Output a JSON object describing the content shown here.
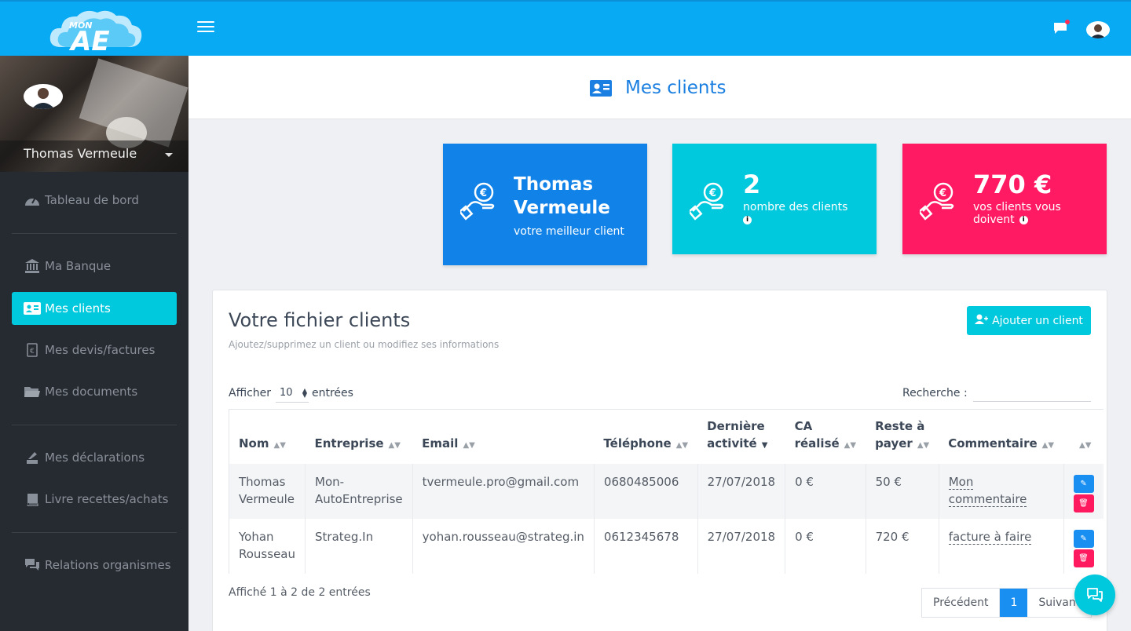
{
  "brand": {
    "logo_small": "MON",
    "logo_big": "AE"
  },
  "topbar": {
    "menu_icon": "hamburger-icon",
    "chat_icon": "chat-icon",
    "avatar": "user-avatar"
  },
  "sidebar": {
    "user_name": "Thomas Vermeule",
    "items": [
      {
        "label": "Tableau de bord",
        "icon": "dashboard-icon"
      },
      {
        "label": "Ma Banque",
        "icon": "bank-icon"
      },
      {
        "label": "Mes clients",
        "icon": "contact-card-icon",
        "active": true
      },
      {
        "label": "Mes devis/factures",
        "icon": "invoice-icon"
      },
      {
        "label": "Mes documents",
        "icon": "folder-icon"
      },
      {
        "label": "Mes déclarations",
        "icon": "declaration-icon"
      },
      {
        "label": "Livre recettes/achats",
        "icon": "book-icon"
      },
      {
        "label": "Relations organismes",
        "icon": "conversation-icon"
      }
    ]
  },
  "page": {
    "title": "Mes clients"
  },
  "cards": [
    {
      "name": "Thomas Vermeule",
      "name_line1": "Thomas",
      "name_line2": "Vermeule",
      "subtitle": "votre meilleur client",
      "color": "#1183e8"
    },
    {
      "value": "2",
      "subtitle": "nombre des clients",
      "color": "#00c8dd"
    },
    {
      "value": "770 €",
      "subtitle_line1": "vos clients vous",
      "subtitle_line2": "doivent",
      "color": "#ff1a63"
    }
  ],
  "panel": {
    "title": "Votre fichier clients",
    "subtitle": "Ajoutez/supprimez un client ou modifiez ses informations",
    "add_button": "Ajouter un client",
    "show_label": "Afficher",
    "show_value": "10",
    "show_suffix": "entrées",
    "search_label": "Recherche :",
    "search_value": ""
  },
  "table": {
    "headers": [
      {
        "line1": "",
        "line2": "Nom"
      },
      {
        "line1": "",
        "line2": "Entreprise"
      },
      {
        "line1": "",
        "line2": "Email"
      },
      {
        "line1": "",
        "line2": "Téléphone"
      },
      {
        "line1": "Dernière",
        "line2": "activité"
      },
      {
        "line1": "CA",
        "line2": "réalisé"
      },
      {
        "line1": "Reste à",
        "line2": "payer"
      },
      {
        "line1": "",
        "line2": "Commentaire"
      }
    ],
    "rows": [
      {
        "nom1": "Thomas",
        "nom2": "Vermeule",
        "ent1": "Mon-",
        "ent2": "AutoEntreprise",
        "email": "tvermeule.pro@gmail.com",
        "tel": "0680485006",
        "date": "27/07/2018",
        "ca": "0 €",
        "reste": "50 €",
        "comment1": "Mon",
        "comment2": "commentaire"
      },
      {
        "nom1": "Yohan",
        "nom2": "Rousseau",
        "ent1": "Strateg.In",
        "ent2": "",
        "email": "yohan.rousseau@strateg.in",
        "tel": "0612345678",
        "date": "27/07/2018",
        "ca": "0 €",
        "reste": "720 €",
        "comment1": "facture à faire",
        "comment2": ""
      }
    ],
    "info": "Affiché 1 à 2 de 2 entrées",
    "pager": {
      "prev": "Précédent",
      "current": "1",
      "next": "Suivant"
    }
  },
  "colors": {
    "topbar": "#07aaf3",
    "accent": "#00c8dd",
    "primary": "#1183e8",
    "danger": "#ff1a63",
    "sidebar": "#262b31"
  }
}
